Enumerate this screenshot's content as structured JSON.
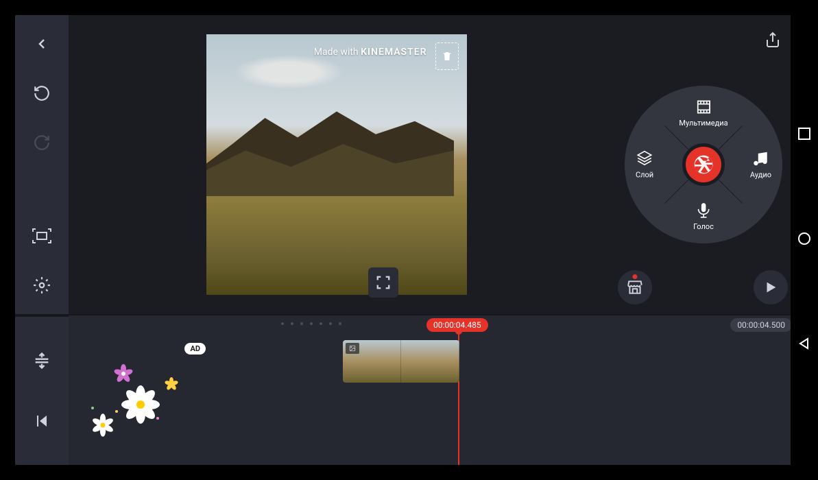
{
  "watermark": {
    "prefix": "Made with",
    "brand": "KINEMASTER"
  },
  "wheel": {
    "media": "Мультимедиа",
    "layer": "Слой",
    "audio": "Аудио",
    "voice": "Голос"
  },
  "timeline": {
    "playhead_time": "00:00:04.485",
    "duration": "00:00:04.500",
    "ad_badge": "AD"
  },
  "icons": {
    "back": "back-icon",
    "undo": "undo-icon",
    "redo": "redo-icon",
    "capture": "capture-icon",
    "settings": "settings-icon",
    "trash": "trash-icon",
    "share": "share-icon",
    "store": "store-icon",
    "play": "play-icon",
    "fullscreen": "fullscreen-icon",
    "shutter": "shutter-icon",
    "media": "media-icon",
    "layer": "layer-icon",
    "audio": "music-note-icon",
    "voice": "microphone-icon",
    "track_expand": "track-expand-icon",
    "skip_start": "skip-start-icon"
  }
}
